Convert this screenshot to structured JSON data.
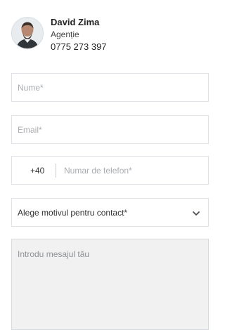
{
  "agent": {
    "name": "David Zima",
    "role": "Agenție",
    "phone": "0775 273 397",
    "avatar_icon": "person-avatar-icon"
  },
  "form": {
    "name": {
      "placeholder": "Nume*"
    },
    "email": {
      "placeholder": "Email*"
    },
    "phone": {
      "prefix": "+40",
      "placeholder": "Numar de telefon*"
    },
    "reason": {
      "selected": "Alege motivul pentru contact*",
      "icon": "chevron-down-icon"
    },
    "message": {
      "placeholder": "Introdu mesajul tău"
    }
  },
  "colors": {
    "border": "#dfe3e7",
    "placeholder": "#a9adb1",
    "message_background": "#f1f1f1",
    "text": "#222222"
  }
}
